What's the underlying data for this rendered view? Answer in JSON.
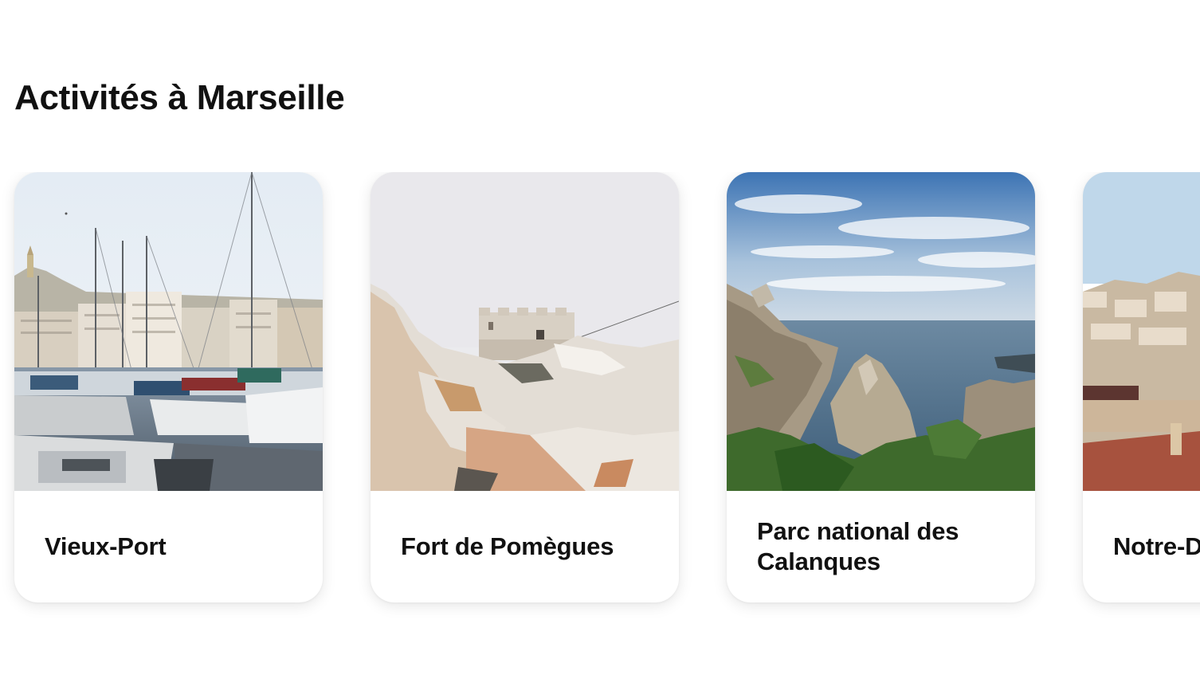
{
  "section": {
    "title": "Activités à Marseille"
  },
  "cards": [
    {
      "title": "Vieux-Port",
      "image": "harbor-boats-photo"
    },
    {
      "title": "Fort de Pomègues",
      "image": "rocky-fort-photo"
    },
    {
      "title": "Parc national des Calanques",
      "image": "calanques-coast-photo"
    },
    {
      "title": "Notre-Dame de la Garde",
      "image": "city-rooftops-photo"
    }
  ]
}
